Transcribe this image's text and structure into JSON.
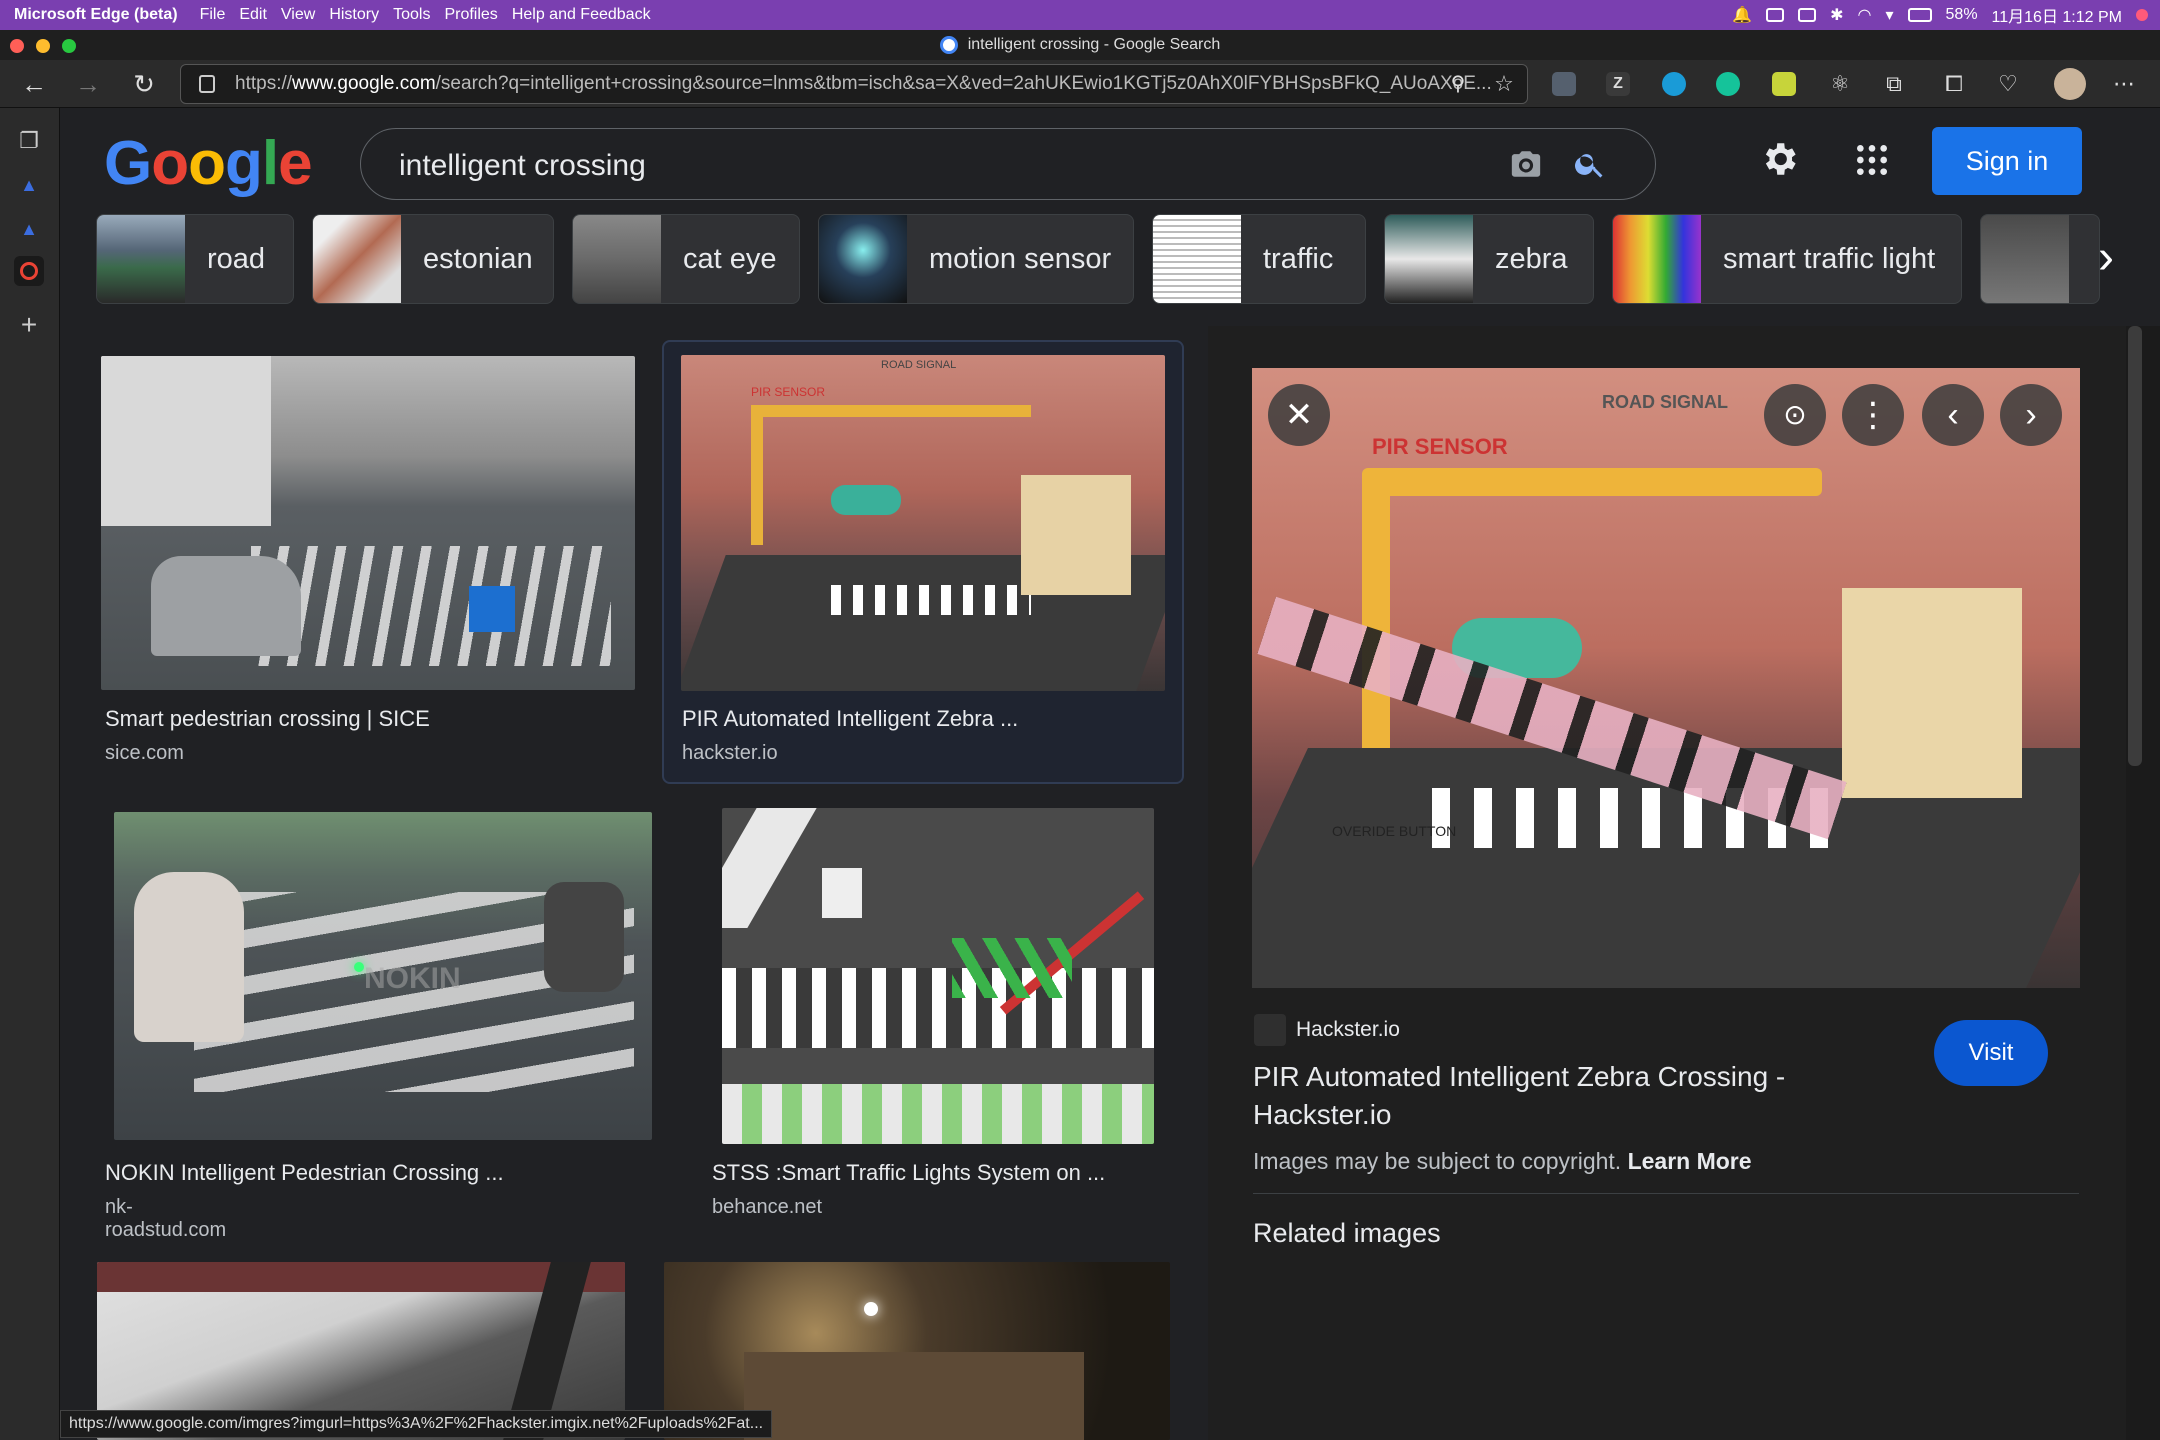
{
  "menubar": {
    "app": "Microsoft Edge (beta)",
    "items": [
      "File",
      "Edit",
      "View",
      "History",
      "Tools",
      "Profiles",
      "Help and Feedback"
    ],
    "battery": "58%",
    "datetime": "11月16日 1:12 PM"
  },
  "window": {
    "title": "intelligent crossing - Google Search"
  },
  "address": {
    "prefix": "https://",
    "host": "www.google.com",
    "path": "/search?q=intelligent+crossing&source=lnms&tbm=isch&sa=X&ved=2ahUKEwio1KGTj5z0AhX0lFYBHSpsBFkQ_AUoAXoE..."
  },
  "search": {
    "query": "intelligent crossing"
  },
  "header": {
    "signin_label": "Sign in"
  },
  "chips": [
    {
      "label": "road",
      "color": "#3a6a4a"
    },
    {
      "label": "estonian",
      "color": "#b26a52"
    },
    {
      "label": "cat eye",
      "color": "#6a6a6a"
    },
    {
      "label": "motion sensor",
      "color": "#27405a"
    },
    {
      "label": "traffic",
      "color": "#e8e8e8"
    },
    {
      "label": "zebra",
      "color": "#2e5c5a"
    },
    {
      "label": "smart traffic light",
      "color": "#c36a3c"
    },
    {
      "label": "",
      "color": "#4a4a4a"
    }
  ],
  "results": [
    {
      "title": "Smart pedestrian crossing | SICE",
      "site": "sice.com"
    },
    {
      "title": "PIR Automated Intelligent Zebra ...",
      "site": "hackster.io"
    },
    {
      "title": "NOKIN Intelligent Pedestrian Crossing ...",
      "site": "nk-roadstud.com"
    },
    {
      "title": "STSS :Smart Traffic Lights System on ...",
      "site": "behance.net"
    }
  ],
  "preview": {
    "source": "Hackster.io",
    "title": "PIR Automated Intelligent Zebra Crossing - Hackster.io",
    "visit_label": "Visit",
    "copyright": "Images may be subject to copyright.",
    "learn_more": "Learn More",
    "related": "Related images",
    "img_labels": {
      "pir": "PIR SENSOR",
      "road": "ROAD SIGNAL",
      "button": "OVERIDE BUTTON"
    }
  },
  "results_img_labels": {
    "nokin": "NOKIN",
    "pir": "PIR SENSOR",
    "road": "ROAD SIGNAL"
  },
  "status_url": "https://www.google.com/imgres?imgurl=https%3A%2F%2Fhackster.imgix.net%2Fuploads%2Fat..."
}
